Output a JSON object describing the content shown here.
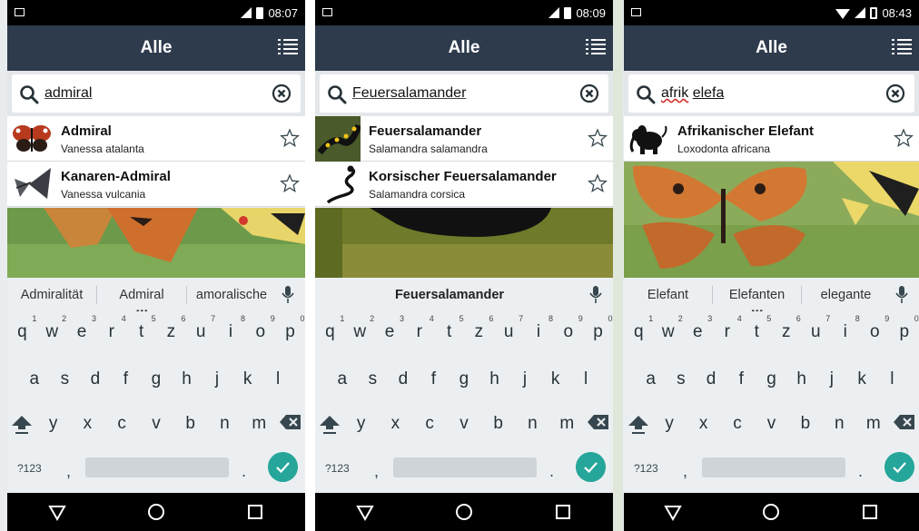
{
  "colors": {
    "appbar": "#2e3b4c",
    "accent_enter": "#26a69a",
    "statusbar": "#000000",
    "keyboard": "#eceff1"
  },
  "icons": [
    "search-icon",
    "clear-icon",
    "list-view-icon",
    "star-icon",
    "mic-icon",
    "shift-icon",
    "backspace-icon",
    "check-icon",
    "back-icon",
    "home-icon",
    "recents-icon"
  ],
  "screens": [
    {
      "status_time": "08:07",
      "title": "Alle",
      "search": {
        "query": "admiral"
      },
      "results": [
        {
          "name": "Admiral",
          "scientific": "Vanessa atalanta"
        },
        {
          "name": "Kanaren-Admiral",
          "scientific": "Vanessa vulcania"
        }
      ],
      "suggestions": [
        "Admiralität",
        "Admiral",
        "amoralische"
      ]
    },
    {
      "status_time": "08:09",
      "title": "Alle",
      "search": {
        "query": "Feuersalamander"
      },
      "results": [
        {
          "name": "Feuersalamander",
          "scientific": "Salamandra salamandra"
        },
        {
          "name": "Korsischer Feuersalamander",
          "scientific": "Salamandra corsica"
        }
      ],
      "suggestions": [
        "Feuersalamander"
      ]
    },
    {
      "status_time": "08:43",
      "title": "Alle",
      "search": {
        "query_word1": "afrik",
        "query_word2": "elefa"
      },
      "results": [
        {
          "name": "Afrikanischer Elefant",
          "scientific": "Loxodonta africana"
        }
      ],
      "suggestions": [
        "Elefant",
        "Elefanten",
        "elegante"
      ]
    }
  ],
  "keyboard": {
    "row1": [
      "q",
      "w",
      "e",
      "r",
      "t",
      "z",
      "u",
      "i",
      "o",
      "p"
    ],
    "row1_hints": [
      "1",
      "2",
      "3",
      "4",
      "5",
      "6",
      "7",
      "8",
      "9",
      "0"
    ],
    "row2": [
      "a",
      "s",
      "d",
      "f",
      "g",
      "h",
      "j",
      "k",
      "l"
    ],
    "row3": [
      "y",
      "x",
      "c",
      "v",
      "b",
      "n",
      "m"
    ],
    "symbols": "?123",
    "comma": ",",
    "period": "."
  }
}
